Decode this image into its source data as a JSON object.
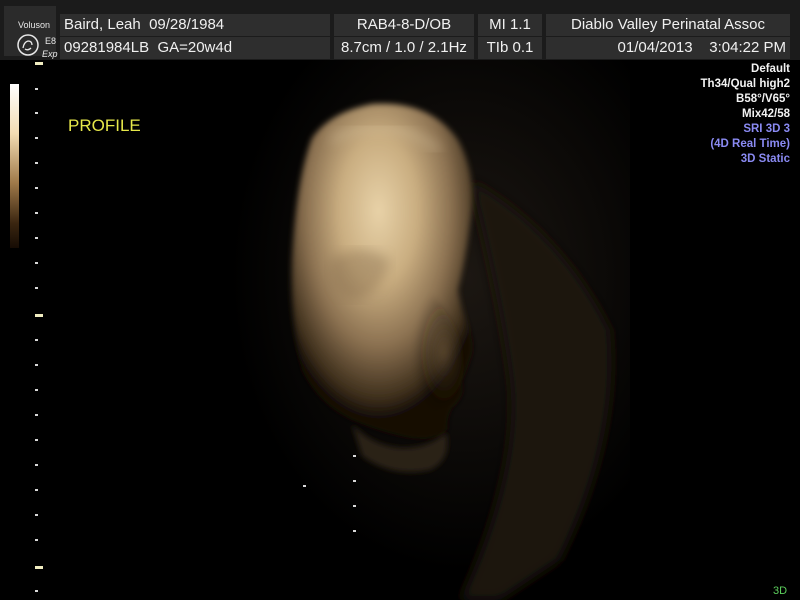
{
  "device": {
    "brand": "Voluson",
    "model": "E8",
    "mode": "Exp"
  },
  "header": {
    "row1": {
      "patient_name": "Baird, Leah",
      "birth_date": "09/28/1984",
      "probe": "RAB4-8-D/OB",
      "mi": "MI  1.1",
      "facility": "Diablo Valley Perinatal  Assoc"
    },
    "row2": {
      "patient_id": "09281984LB",
      "gestational_age": "GA=20w4d",
      "depth_info": "8.7cm / 1.0 / 2.1Hz",
      "tib": "TIb  0.1",
      "date": "01/04/2013",
      "time": "3:04:22 PM"
    }
  },
  "image": {
    "annotation": "PROFILE",
    "render_mode": "3D"
  },
  "parameters": {
    "lines": [
      {
        "text": "Default",
        "color": "#f2f2f2"
      },
      {
        "text": "Th34/Qual high2",
        "color": "#f2f2f2"
      },
      {
        "text": "B58°/V65°",
        "color": "#f2f2f2"
      },
      {
        "text": "Mix42/58",
        "color": "#f2f2f2"
      },
      {
        "text": "SRI 3D 3",
        "color": "#8a8af2"
      },
      {
        "text": "(4D Real Time)",
        "color": "#8a8af2"
      },
      {
        "text": "3D Static",
        "color": "#8a8af2"
      }
    ]
  },
  "colors": {
    "background": "#000000",
    "header_cell": "#2e2e2e",
    "annotation": "#e6e84a",
    "render_mode": "#5ccf5c",
    "sepia_highlight": "#e8d2a8"
  }
}
